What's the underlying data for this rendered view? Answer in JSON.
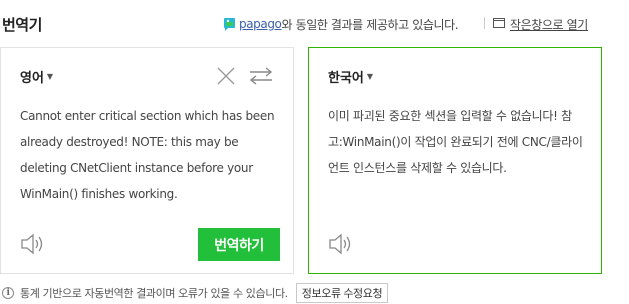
{
  "header": {
    "title": "번역기",
    "papago_label": "papago",
    "powered_text": "와 동일한 결과를 제공하고 있습니다.",
    "open_new_label": "작은창으로 열기"
  },
  "source": {
    "language": "영어",
    "text": "Cannot enter critical section which has been already destroyed! NOTE: this may be deleting CNetClient instance before your WinMain() finishes working."
  },
  "target": {
    "language": "한국어",
    "text": "이미 파괴된 중요한 섹션을 입력할 수 없습니다! 참고:WinMain()이 작업이 완료되기 전에 CNC/클라이언트 인스턴스를 삭제할 수 있습니다."
  },
  "translate_button": "번역하기",
  "footer": {
    "info_icon_glyph": "i",
    "notice": "통계 기반으로 자동번역한 결과이며 오류가 있을 수 있습니다.",
    "report_button": "정보오류 수정요청"
  },
  "colors": {
    "accent": "#21bf3a",
    "target_border": "#2db400",
    "link": "#3a5fa8"
  }
}
